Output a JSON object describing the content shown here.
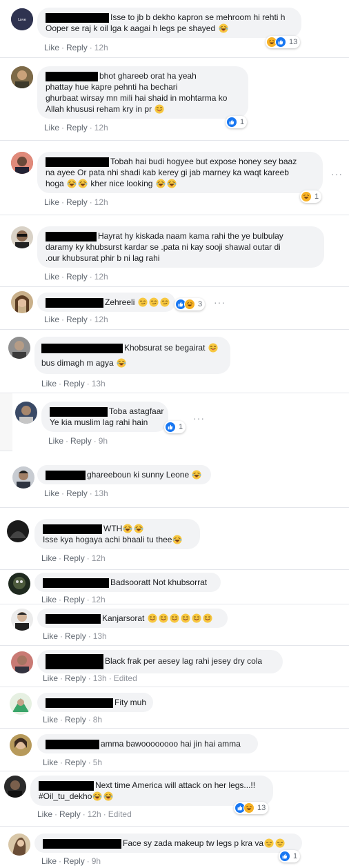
{
  "actions": {
    "like": "Like",
    "reply": "Reply",
    "sep": "·",
    "edited": "Edited"
  },
  "colors": {
    "like_blue": "#1877f2",
    "haha_yellow": "#f7b125",
    "bubble": "#f2f3f5",
    "meta": "#90949c"
  },
  "comments": [
    {
      "lines": [
        "Isse to jb b dekho kapron se mehroom hi rehti h",
        "Ooper se raj k oil lga k aagai h legs pe shayed"
      ],
      "time": "12h",
      "reactions": [
        "haha",
        "like"
      ],
      "react_count": "13"
    },
    {
      "lines": [
        "bhot ghareeb orat ha yeah",
        "phattay hue kapre pehnti ha bechari",
        "ghurbaat wirsay mn mili hai shaid in mohtarma ko",
        "Allah khususi reham kry in pr"
      ],
      "time": "12h",
      "reactions": [
        "like"
      ],
      "react_count": "1"
    },
    {
      "lines": [
        "Tobah hai budi hogyee but expose honey sey baaz",
        "na ayee Or pata nhi shadi kab kerey gi jab marney ka waqt kareeb",
        "hoga",
        "kher nice looking"
      ],
      "time": "12h",
      "reactions": [
        "haha"
      ],
      "react_count": "1"
    },
    {
      "lines": [
        "Hayrat hy kiskada naam kama rahi the ye bulbulay",
        "daramy ky khubsurst kardar se .pata ni kay sooji shawal outar di",
        ".our khubsurat phir b ni lag rahi"
      ],
      "time": "12h"
    },
    {
      "lines": [
        "Zehreeli"
      ],
      "time": "12h",
      "reactions": [
        "like",
        "haha"
      ],
      "react_count": "3"
    },
    {
      "lines": [
        "Khobsurat se begairat",
        "bus dimagh m agya"
      ],
      "time": "13h"
    },
    {
      "lines": [
        "Toba astagfaar",
        "Ye kia muslim lag rahi hain"
      ],
      "time": "9h",
      "reactions": [
        "like"
      ],
      "react_count": "1"
    },
    {
      "lines": [
        "ghareeboun ki sunny Leone"
      ],
      "time": "13h"
    },
    {
      "lines": [
        "WTH",
        "Isse kya hogaya achi bhaali tu thee"
      ],
      "time": "12h"
    },
    {
      "lines": [
        "Badsooratt Not khubsorrat"
      ],
      "time": "12h"
    },
    {
      "lines": [
        "Kanjarsorat"
      ],
      "time": "13h"
    },
    {
      "lines": [
        "Black frak per aesey lag rahi jesey dry cola"
      ],
      "time": "13h",
      "edited": true
    },
    {
      "lines": [
        "Fity muh"
      ],
      "time": "8h"
    },
    {
      "lines": [
        "amma bawoooooooo hai jin hai amma"
      ],
      "time": "5h"
    },
    {
      "lines": [
        "Next time America will attack on her legs...!!",
        "#Oil_tu_dekho"
      ],
      "time": "12h",
      "edited": true,
      "reactions": [
        "like",
        "haha"
      ],
      "react_count": "13"
    },
    {
      "lines": [
        "Face sy zada makeup tw legs p kra va"
      ],
      "time": "9h",
      "reactions": [
        "like"
      ],
      "react_count": "1"
    }
  ]
}
